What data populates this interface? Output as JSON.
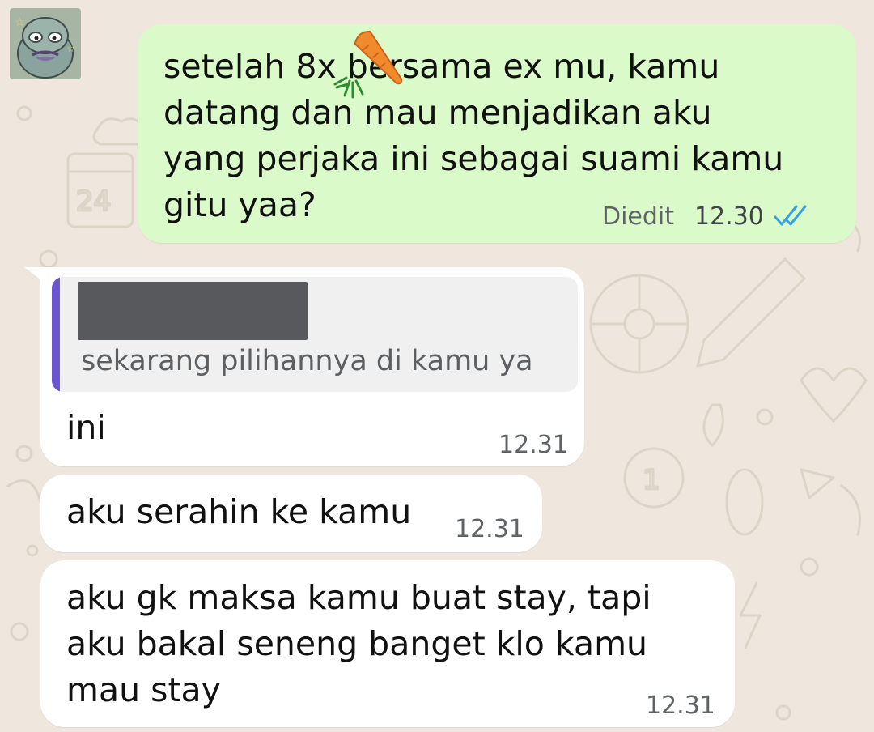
{
  "chat": {
    "messages": [
      {
        "direction": "outgoing",
        "text": "setelah 8x bersama ex mu, kamu\ndatang dan mau menjadikan aku\nyang perjaka ini sebagai suami kamu\ngitu yaa?",
        "edited_label": "Diedit",
        "time": "12.30",
        "status_icon": "double-check-read-icon",
        "inline_emoji": "carrot-icon"
      },
      {
        "direction": "incoming",
        "quoted_text": "sekarang pilihannya di kamu ya",
        "quoted_author_redacted": true,
        "text": "ini",
        "time": "12.31"
      },
      {
        "direction": "incoming",
        "text": "aku serahin ke kamu",
        "time": "12.31"
      },
      {
        "direction": "incoming",
        "text": "aku gk maksa kamu buat stay, tapi\naku bakal seneng banget klo kamu\nmau stay",
        "time": "12.31"
      }
    ]
  },
  "colors": {
    "wallpaper": "#efe7dd",
    "outgoing_bubble": "#dbfac9",
    "incoming_bubble": "#ffffff",
    "quote_accent": "#6c56cc",
    "read_tick": "#34b7f1"
  }
}
